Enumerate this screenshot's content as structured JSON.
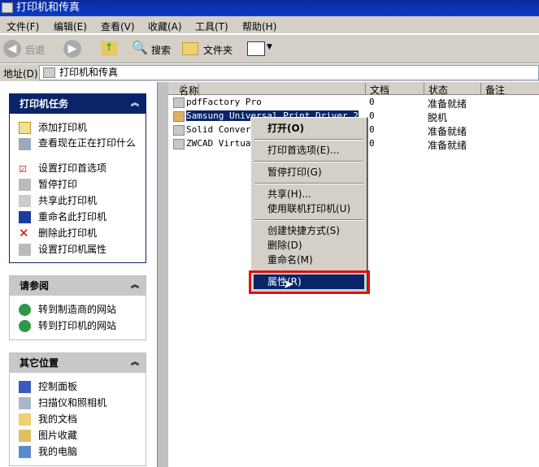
{
  "window": {
    "title": "打印机和传真"
  },
  "menubar": [
    "文件(F)",
    "编辑(E)",
    "查看(V)",
    "收藏(A)",
    "工具(T)",
    "帮助(H)"
  ],
  "toolbar": {
    "back": "后退",
    "search": "搜索",
    "folders": "文件夹"
  },
  "address": {
    "label": "地址(D)",
    "value": "打印机和传真"
  },
  "panels": [
    {
      "title": "打印机任务",
      "items": [
        "添加打印机",
        "查看现在正在打印什么",
        "设置打印首选项",
        "暂停打印",
        "共享此打印机",
        "重命名此打印机",
        "删除此打印机",
        "设置打印机属性"
      ]
    },
    {
      "title": "请参阅",
      "items": [
        "转到制造商的网站",
        "转到打印机的网站"
      ]
    },
    {
      "title": "其它位置",
      "items": [
        "控制面板",
        "扫描仪和照相机",
        "我的文档",
        "图片收藏",
        "我的电脑"
      ]
    }
  ],
  "columns": [
    "名称",
    "文档",
    "状态",
    "备注"
  ],
  "rows": [
    {
      "name": "pdfFactory Pro",
      "docs": "0",
      "status": "准备就绪"
    },
    {
      "name": "Samsung Universal Print Driver 2",
      "docs": "0",
      "status": "脱机",
      "selected": true
    },
    {
      "name": "Solid Converter PDF",
      "docs": "0",
      "status": "准备就绪"
    },
    {
      "name": "ZWCAD Virtual Printer",
      "docs": "0",
      "status": "准备就绪"
    }
  ],
  "context_menu": [
    "打开(O)",
    "打印首选项(E)...",
    "暂停打印(G)",
    "共享(H)...",
    "使用联机打印机(U)",
    "创建快捷方式(S)",
    "删除(D)",
    "重命名(M)",
    "属性(R)"
  ],
  "colors": {
    "title_bar": "#0a2a9a",
    "selection": "#0a246a",
    "highlight_box": "#e01010"
  }
}
